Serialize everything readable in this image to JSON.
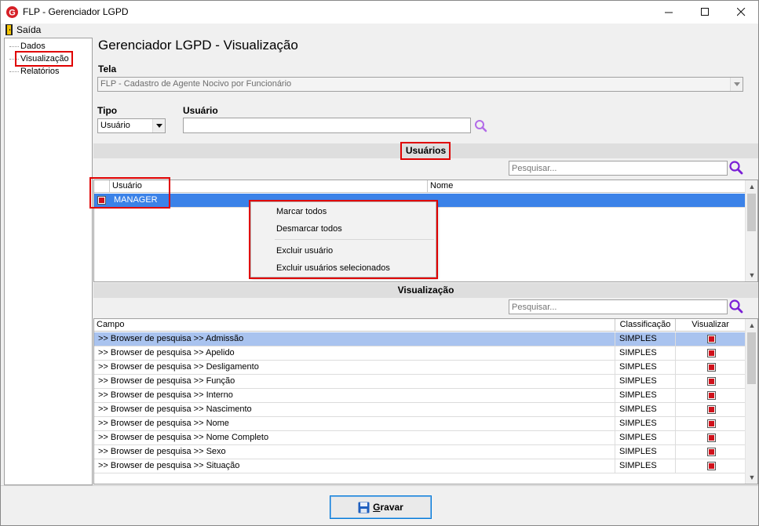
{
  "window": {
    "title": "FLP - Gerenciador LGPD"
  },
  "menubar": {
    "exit_label": "Saída"
  },
  "tree": {
    "items": [
      {
        "label": "Dados"
      },
      {
        "label": "Visualização"
      },
      {
        "label": "Relatórios"
      }
    ]
  },
  "page": {
    "title": "Gerenciador LGPD - Visualização"
  },
  "tela": {
    "label": "Tela",
    "value": "FLP - Cadastro de Agente Nocivo por Funcionário"
  },
  "tipo": {
    "label": "Tipo",
    "value": "Usuário"
  },
  "usuario": {
    "label": "Usuário",
    "value": ""
  },
  "users_section": {
    "header": "Usuários",
    "search_placeholder": "Pesquisar...",
    "columns": [
      "Usuário",
      "Nome"
    ],
    "rows": [
      {
        "user": "MANAGER",
        "name": "",
        "checked": true
      }
    ]
  },
  "context_menu": {
    "items": [
      "Marcar todos",
      "Desmarcar todos",
      "Excluir usuário",
      "Excluir usuários selecionados"
    ]
  },
  "view_section": {
    "header": "Visualização",
    "search_placeholder": "Pesquisar...",
    "columns": [
      "Campo",
      "Classificação",
      "Visualizar"
    ],
    "rows": [
      {
        "campo": ">> Browser de pesquisa >> Admissão",
        "class": "SIMPLES",
        "visualizar": true
      },
      {
        "campo": ">> Browser de pesquisa >> Apelido",
        "class": "SIMPLES",
        "visualizar": true
      },
      {
        "campo": ">> Browser de pesquisa >> Desligamento",
        "class": "SIMPLES",
        "visualizar": true
      },
      {
        "campo": ">> Browser de pesquisa >> Função",
        "class": "SIMPLES",
        "visualizar": true
      },
      {
        "campo": ">> Browser de pesquisa >> Interno",
        "class": "SIMPLES",
        "visualizar": true
      },
      {
        "campo": ">> Browser de pesquisa >> Nascimento",
        "class": "SIMPLES",
        "visualizar": true
      },
      {
        "campo": ">> Browser de pesquisa >> Nome",
        "class": "SIMPLES",
        "visualizar": true
      },
      {
        "campo": ">> Browser de pesquisa >> Nome Completo",
        "class": "SIMPLES",
        "visualizar": true
      },
      {
        "campo": ">> Browser de pesquisa >> Sexo",
        "class": "SIMPLES",
        "visualizar": true
      },
      {
        "campo": ">> Browser de pesquisa >> Situação",
        "class": "SIMPLES",
        "visualizar": true
      }
    ]
  },
  "footer": {
    "save_label_underlined": "G",
    "save_label_rest": "ravar"
  },
  "colors": {
    "highlight_red": "#e00000",
    "check_red": "#d0111b",
    "selection_blue": "#3b82e8",
    "row_highlight": "#a9c3ef",
    "search_purple": "#8a2be2"
  },
  "icons": [
    "app-logo-icon",
    "exit-door-icon",
    "search-icon",
    "dropdown-arrow-icon",
    "save-floppy-icon"
  ]
}
